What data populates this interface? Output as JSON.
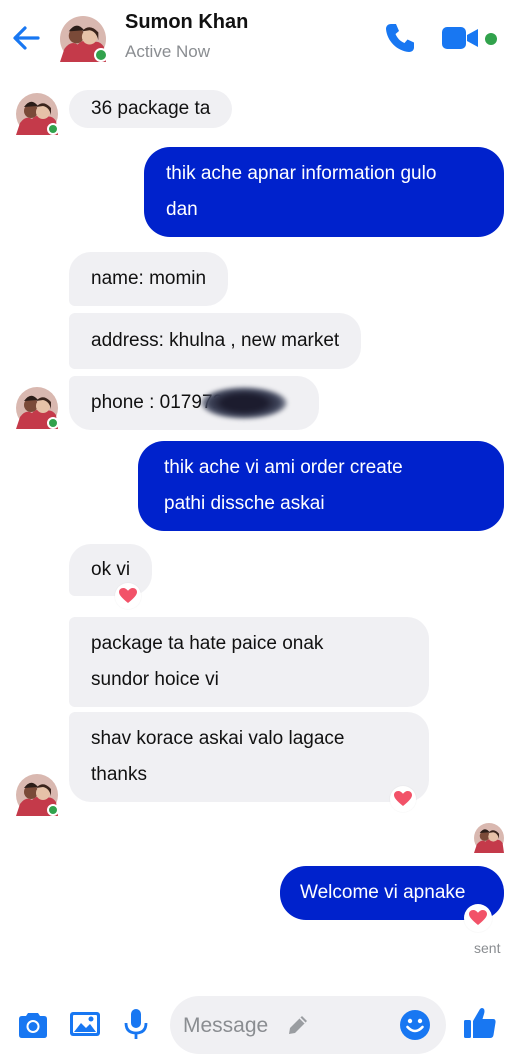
{
  "header": {
    "name": "Sumon Khan",
    "status": "Active Now"
  },
  "messages": [
    {
      "from": "them",
      "text": "36 package ta"
    },
    {
      "from": "me",
      "lines": [
        "thik ache apnar information gulo",
        "dan"
      ]
    },
    {
      "from": "them",
      "text": "name: momin"
    },
    {
      "from": "them",
      "text": "address: khulna , new market"
    },
    {
      "from": "them",
      "text": "phone : 017972",
      "redacted": true
    },
    {
      "from": "me",
      "lines": [
        "thik ache vi ami order create",
        "pathi dissche askai"
      ]
    },
    {
      "from": "them",
      "text": "ok vi",
      "reaction": "heart"
    },
    {
      "from": "them",
      "lines": [
        "package ta hate paice onak",
        "sundor hoice vi"
      ]
    },
    {
      "from": "them",
      "lines": [
        "shav korace askai valo lagace",
        "thanks"
      ],
      "reaction": "heart"
    },
    {
      "from": "me",
      "text": "Welcome vi apnake",
      "reaction": "heart"
    }
  ],
  "sent_label": "sent",
  "composer": {
    "placeholder": "Message"
  },
  "colors": {
    "accent": "#0022cc",
    "icon_blue": "#1877f2",
    "incoming_bubble": "#f0f0f3",
    "online": "#31a24c",
    "heart": "#f25268"
  }
}
